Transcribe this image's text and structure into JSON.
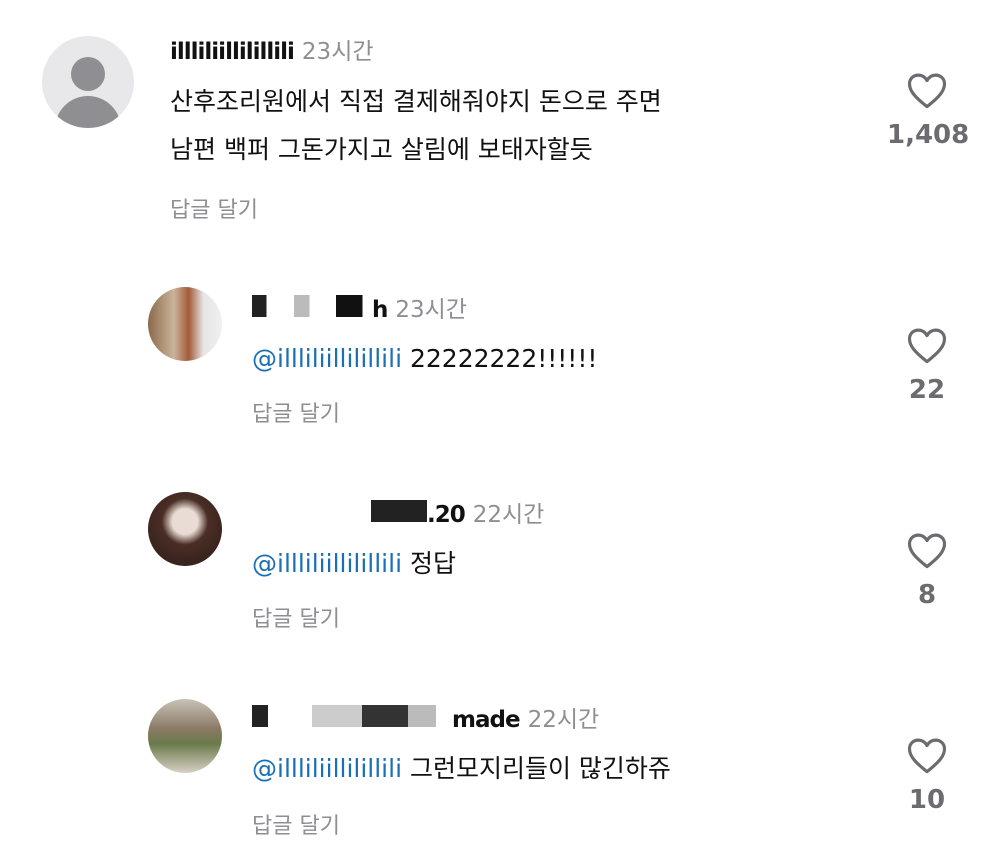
{
  "comments": [
    {
      "username": "illliliillilillili",
      "time": "23시간",
      "mention": "",
      "lines": [
        "산후조리원에서 직접 결제해줘야지 돈으로 주면",
        "남편 백퍼 그돈가지고 살림에 보태자할듯"
      ],
      "reply_label": "답글 달기",
      "likes": "1,408"
    },
    {
      "username_visible": "h",
      "time": "23시간",
      "mention": "@illliliillilillili",
      "text": "22222222!!!!!!",
      "reply_label": "답글 달기",
      "likes": "22"
    },
    {
      "username_visible": ".20",
      "time": "22시간",
      "mention": "@illliliillilillili",
      "text": "정답",
      "reply_label": "답글 달기",
      "likes": "8"
    },
    {
      "username_visible": "made",
      "time": "22시간",
      "mention": "@illliliillilillili",
      "text": "그런모지리들이 많긴하쥬",
      "reply_label": "답글 달기",
      "likes": "10"
    }
  ],
  "icons": {
    "like": "heart-icon",
    "avatar_default": "person-icon",
    "mention": "threads-at-icon"
  },
  "colors": {
    "mention": "#1a6fb5",
    "muted": "#8e8e93",
    "text": "#111111"
  }
}
